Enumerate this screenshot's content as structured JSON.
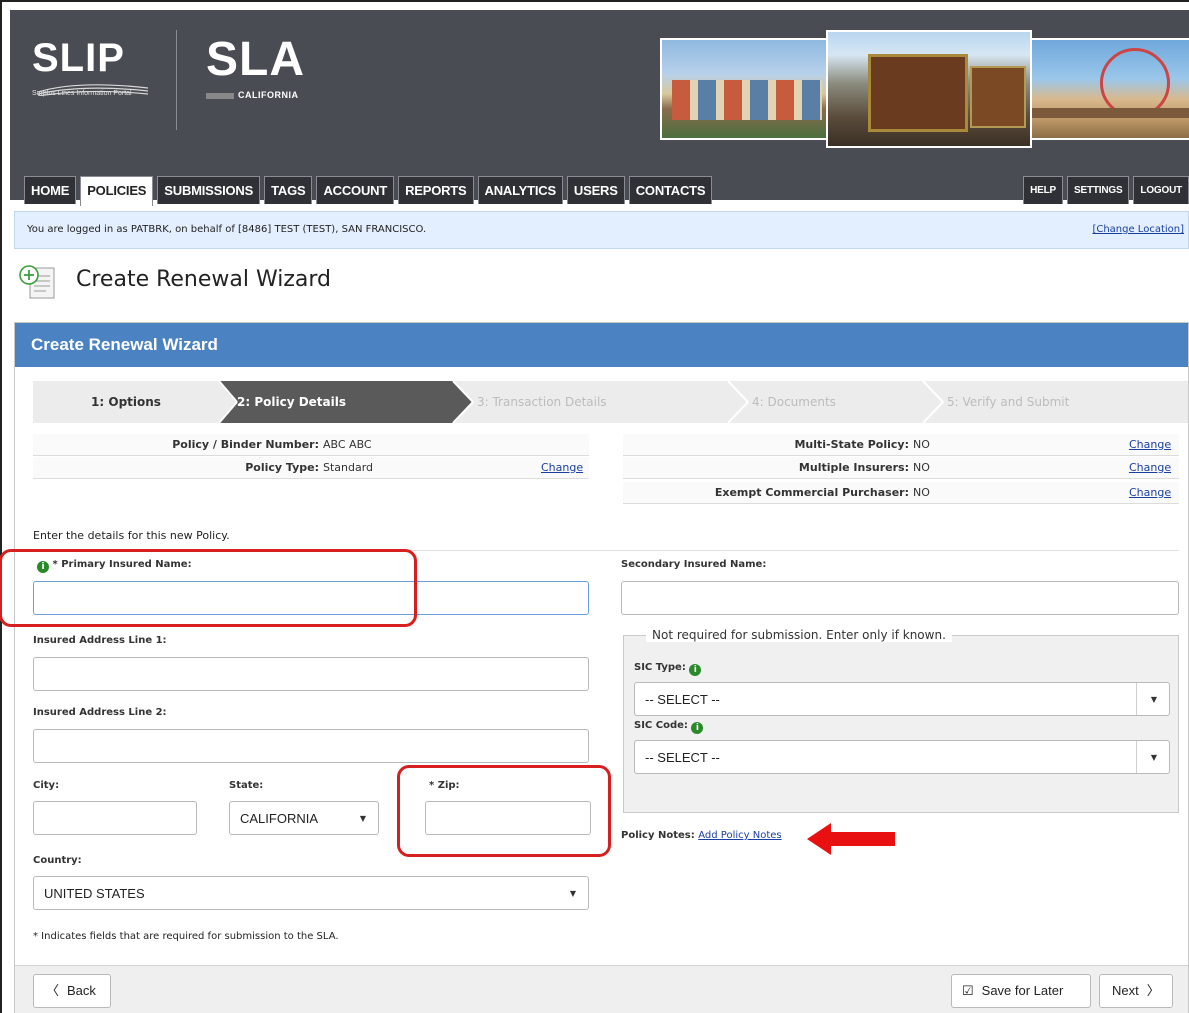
{
  "header": {
    "slip_logo": "SLIP",
    "slip_tagline": "Surplus Lines Information Portal",
    "sla_logo": "SLA",
    "sla_sub": "CALIFORNIA"
  },
  "nav": {
    "left": [
      "HOME",
      "POLICIES",
      "SUBMISSIONS",
      "TAGS",
      "ACCOUNT",
      "REPORTS",
      "ANALYTICS",
      "USERS",
      "CONTACTS"
    ],
    "right": [
      "HELP",
      "SETTINGS",
      "LOGOUT"
    ],
    "active": "POLICIES"
  },
  "banner": {
    "text": "You are logged in as PATBRK, on behalf of [8486] TEST (TEST), SAN FRANCISCO.",
    "link": "[Change Location]"
  },
  "page": {
    "title": "Create Renewal Wizard"
  },
  "panel": {
    "title": "Create Renewal Wizard"
  },
  "steps": [
    {
      "label": "1: Options"
    },
    {
      "label": "2: Policy Details"
    },
    {
      "label": "3: Transaction Details"
    },
    {
      "label": "4: Documents"
    },
    {
      "label": "5: Verify and Submit"
    }
  ],
  "policy_info": {
    "binder_label": "Policy / Binder Number:",
    "binder_value": "ABC ABC",
    "type_label": "Policy Type:",
    "type_value": "Standard",
    "change": "Change",
    "multi_state_label": "Multi-State Policy:",
    "multi_state_value": "NO",
    "multi_insurers_label": "Multiple Insurers:",
    "multi_insurers_value": "NO",
    "exempt_label": "Exempt Commercial Purchaser:",
    "exempt_value": "NO"
  },
  "form": {
    "intro": "Enter the details for this new Policy.",
    "primary_label": "* Primary Insured Name:",
    "secondary_label": "Secondary Insured Name:",
    "addr1_label": "Insured Address Line 1:",
    "addr2_label": "Insured Address Line 2:",
    "city_label": "City:",
    "state_label": "State:",
    "state_value": "CALIFORNIA",
    "zip_label": "* Zip:",
    "country_label": "Country:",
    "country_value": "UNITED STATES",
    "fieldset_legend": "Not required for submission. Enter only if known.",
    "sic_type_label": "SIC Type:",
    "sic_type_value": "-- SELECT --",
    "sic_code_label": "SIC Code:",
    "sic_code_value": "-- SELECT --",
    "policy_notes_label": "Policy Notes:",
    "policy_notes_link": "Add Policy Notes",
    "required_note": "* Indicates fields that are required for submission to the SLA."
  },
  "footer": {
    "back": "Back",
    "save": "Save for Later",
    "next": "Next"
  }
}
